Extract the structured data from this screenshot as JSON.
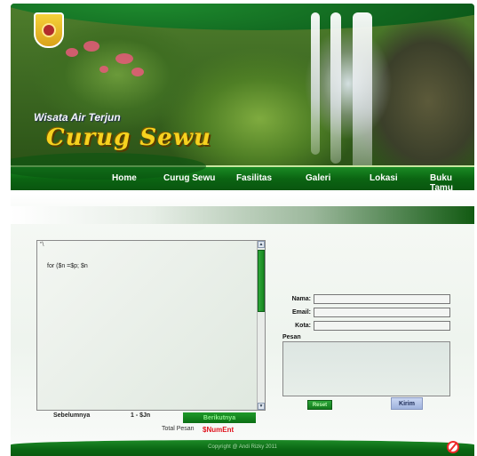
{
  "header": {
    "subtitle": "Wisata Air Terjun",
    "title": "Curug Sewu",
    "logo": "emblem-icon"
  },
  "nav": {
    "items": [
      "Home",
      "Curug Sewu",
      "Fasilitas",
      "Galeri",
      "Lokasi",
      "Buku Tamu"
    ]
  },
  "guestbook": {
    "scroll_marker": "\"\\",
    "message_text": "for ($n =$p;  $n",
    "pager": {
      "prev": "Sebelumnya",
      "range": "1  - $Jn",
      "next": "Berikutnya"
    },
    "total_label": "Total Pesan",
    "total_value": "$NumEnt"
  },
  "form": {
    "name_label": "Nama:",
    "email_label": "Email:",
    "city_label": "Kota:",
    "message_label": "Pesan",
    "reset_label": "Reset",
    "send_label": "Kirim"
  },
  "footer": {
    "copyright": "Copyright @ Andi Rizky 2011"
  },
  "colors": {
    "brand_green": "#0b6512",
    "title_yellow": "#f7d21f",
    "total_red": "#e0141e"
  }
}
